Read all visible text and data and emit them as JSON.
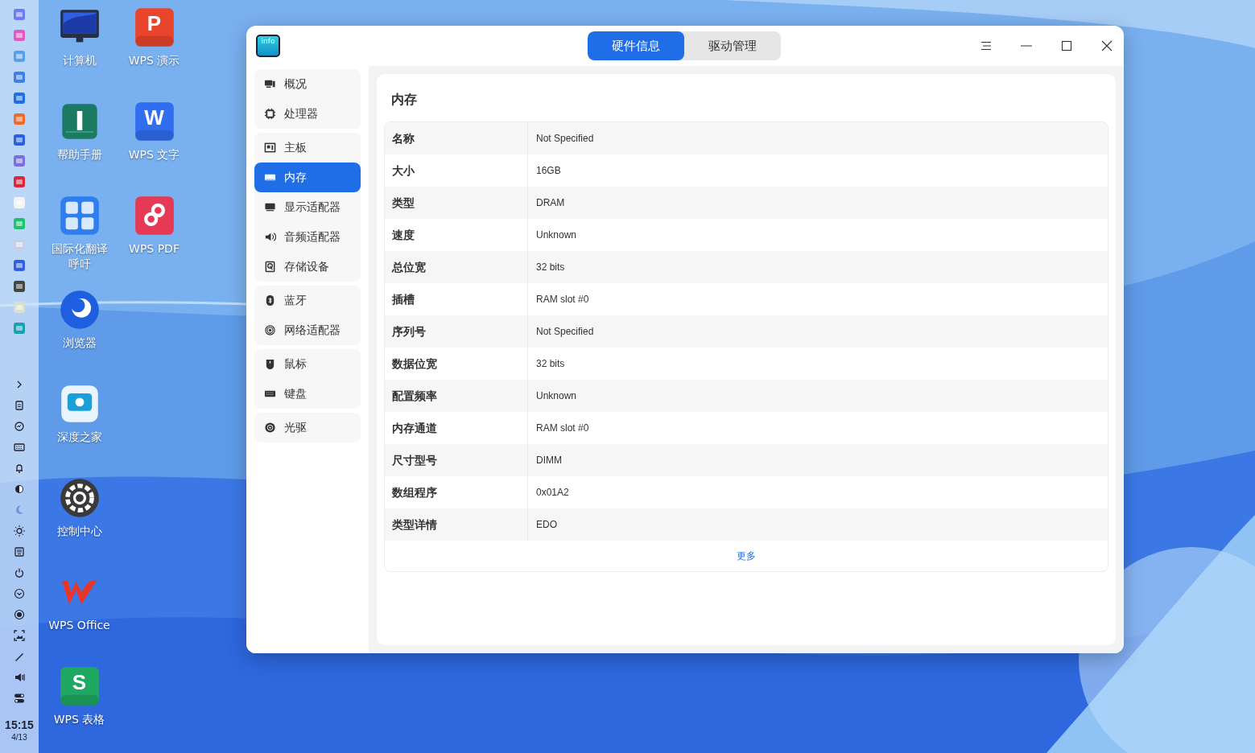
{
  "dock": {
    "time": "15:15",
    "date": "4/13"
  },
  "desktop_icons": [
    {
      "label": "计算机",
      "kind": "monitor"
    },
    {
      "label": "帮助手册",
      "kind": "help"
    },
    {
      "label": "国际化翻译呼吁",
      "kind": "translate"
    },
    {
      "label": "浏览器",
      "kind": "browser"
    },
    {
      "label": "深度之家",
      "kind": "home"
    },
    {
      "label": "控制中心",
      "kind": "control"
    },
    {
      "label": "WPS Office",
      "kind": "wps-office"
    },
    {
      "label": "WPS 表格",
      "kind": "wps-sheet",
      "glyph": "S"
    },
    {
      "label": "WPS 演示",
      "kind": "wps-present",
      "glyph": "P"
    },
    {
      "label": "WPS 文字",
      "kind": "wps-writer",
      "glyph": "W"
    },
    {
      "label": "WPS PDF",
      "kind": "wps-pdf"
    }
  ],
  "window": {
    "app_icon_text": "info",
    "tabs": [
      {
        "label": "硬件信息",
        "selected": true
      },
      {
        "label": "驱动管理",
        "selected": false
      }
    ],
    "sidebar": [
      {
        "items": [
          {
            "label": "概况",
            "kind": "overview",
            "selected": false
          },
          {
            "label": "处理器",
            "kind": "cpu",
            "selected": false
          }
        ]
      },
      {
        "items": [
          {
            "label": "主板",
            "kind": "board",
            "selected": false
          },
          {
            "label": "内存",
            "kind": "memory",
            "selected": true
          },
          {
            "label": "显示适配器",
            "kind": "display",
            "selected": false
          },
          {
            "label": "音频适配器",
            "kind": "audio",
            "selected": false
          },
          {
            "label": "存储设备",
            "kind": "storage",
            "selected": false
          }
        ]
      },
      {
        "items": [
          {
            "label": "蓝牙",
            "kind": "bluetooth",
            "selected": false
          },
          {
            "label": "网络适配器",
            "kind": "network",
            "selected": false
          }
        ]
      },
      {
        "items": [
          {
            "label": "鼠标",
            "kind": "mouse",
            "selected": false
          },
          {
            "label": "键盘",
            "kind": "keyboard",
            "selected": false
          }
        ]
      },
      {
        "items": [
          {
            "label": "光驱",
            "kind": "disc",
            "selected": false
          }
        ]
      }
    ],
    "content": {
      "title": "内存",
      "rows": [
        {
          "name": "名称",
          "value": "Not Specified"
        },
        {
          "name": "大小",
          "value": "16GB"
        },
        {
          "name": "类型",
          "value": "DRAM"
        },
        {
          "name": "速度",
          "value": "Unknown"
        },
        {
          "name": "总位宽",
          "value": "32 bits"
        },
        {
          "name": "插槽",
          "value": "RAM slot #0"
        },
        {
          "name": "序列号",
          "value": "Not Specified"
        },
        {
          "name": "数据位宽",
          "value": "32 bits"
        },
        {
          "name": "配置频率",
          "value": "Unknown"
        },
        {
          "name": "内存通道",
          "value": "RAM slot #0"
        },
        {
          "name": "尺寸型号",
          "value": "DIMM"
        },
        {
          "name": "数组程序",
          "value": "0x01A2"
        },
        {
          "name": "类型详情",
          "value": "EDO"
        }
      ],
      "more_link": "更多"
    }
  }
}
